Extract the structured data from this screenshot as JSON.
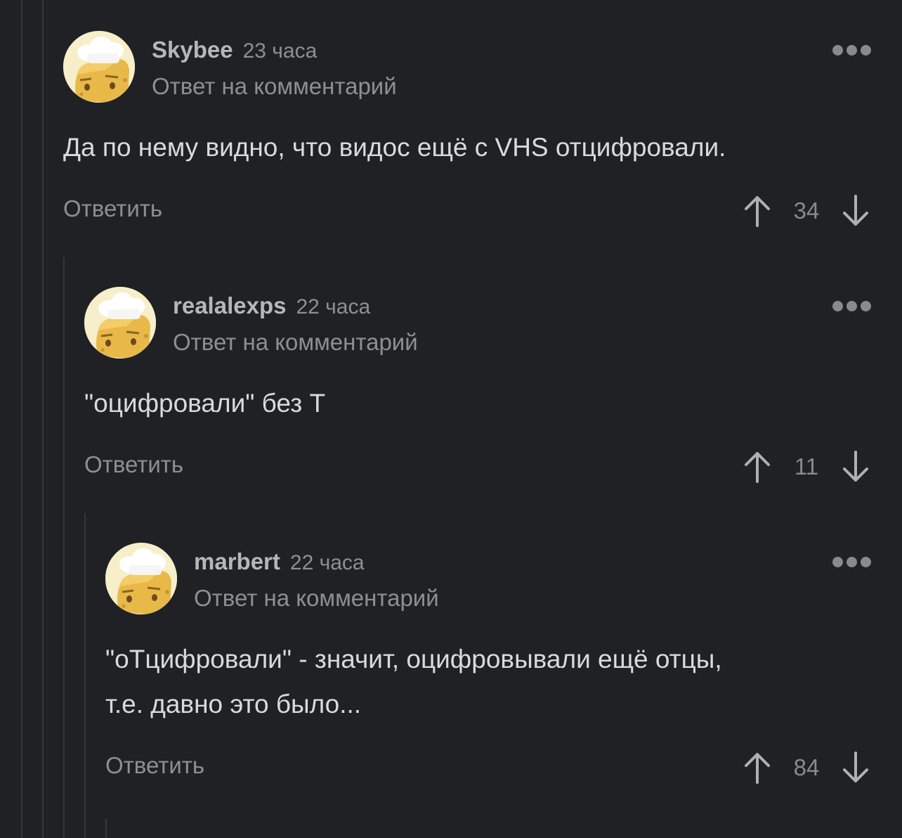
{
  "comments": [
    {
      "author": "Skybee",
      "time": "23 часа",
      "reply_to": "Ответ на комментарий",
      "text": "Да по нему видно, что видос ещё с VHS отцифровали.",
      "reply_label": "Ответить",
      "score": "34"
    },
    {
      "author": "realalexps",
      "time": "22 часа",
      "reply_to": "Ответ на комментарий",
      "text": "\"оцифровали\" без Т",
      "reply_label": "Ответить",
      "score": "11"
    },
    {
      "author": "marbert",
      "time": "22 часа",
      "reply_to": "Ответ на комментарий",
      "text": "\"оТцифровали\" - значит, оцифровывали ещё отцы,\nт.е. давно это было...",
      "reply_label": "Ответить",
      "score": "84"
    }
  ],
  "icons": {
    "avatar": "chef-hat-cheese-avatar-icon",
    "more": "more-dots-icon",
    "upvote": "arrow-up-icon",
    "downvote": "arrow-down-icon"
  }
}
